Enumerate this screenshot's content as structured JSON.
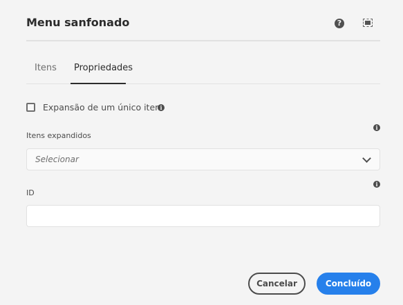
{
  "dialog": {
    "title": "Menu sanfonado",
    "help_icon": "?",
    "tabs": [
      {
        "label": "Itens",
        "active": false
      },
      {
        "label": "Propriedades",
        "active": true
      }
    ],
    "single_expansion": {
      "label": "Expansão de um único item",
      "checked": false
    },
    "expanded_items": {
      "label": "Itens expandidos",
      "placeholder": "Selecionar"
    },
    "id_field": {
      "label": "ID",
      "value": ""
    },
    "info_glyph": "i",
    "buttons": {
      "cancel": "Cancelar",
      "done": "Concluído"
    },
    "colors": {
      "accent": "#2680eb",
      "background": "#f4f4f4"
    }
  }
}
